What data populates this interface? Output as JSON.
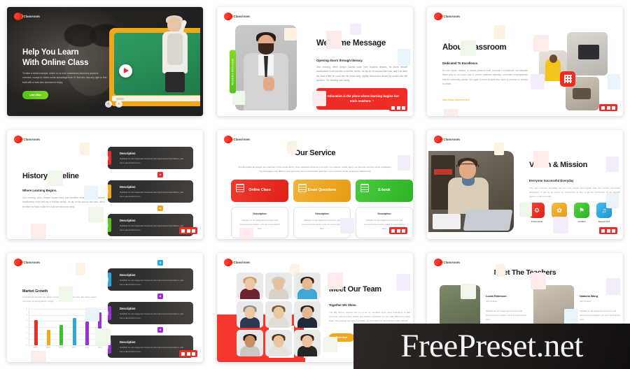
{
  "brand": {
    "logo_text": "Classroom",
    "accent_red": "#ee2b24",
    "accent_orange": "#f0a91e",
    "accent_green": "#56c51c",
    "accent_blue": "#2aa9e0",
    "accent_purple": "#9b30d9"
  },
  "watermark": {
    "text": "FreePreset.net"
  },
  "slides": [
    {
      "id": "hero",
      "title_line1": "Help You Learn",
      "title_line2": "With Online Class",
      "body": "To take a trivial example, which of us ever undertakes laborious physical exercise, except to obtain some advantage from it? But who has any right to find fault with a man who chooses to enjoy",
      "button": "Learn More",
      "prev": "‹",
      "next": "›"
    },
    {
      "id": "welcome",
      "vertical_tab": "Richard's First Issue",
      "heading": "Welcome Message",
      "subhead": "Opening doors through literacy.",
      "body": "One morning, when Gregor Samsa woke from troubled dreams, he found himself transformed in his bed into a horrible vermin. He lay on his armour-like back, and if he lifted his head a little he could see his brown belly, slightly domed and divided by arches into stiff sections. The bedding was hardly.",
      "quote": "“ Education is the place where learning begins but ends nowhere. ”"
    },
    {
      "id": "about",
      "heading": "About Classroom",
      "subhead": "Dedicated To Excellence.",
      "body": "No one rejects, dislikes, or avoids pleasure itself, because it is pleasure, but because those who do not know how to pursue pleasure rationally encounter consequences that are extremely painful. Nor again is there anyone who loves or pursues or desires to obtain.",
      "link": "https://www.classroom.com"
    },
    {
      "id": "history-timeline",
      "heading": "History Timeline",
      "subhead": "Where Learning Begins.",
      "body": "One morning, when Gregor Samsa woke from troubled dreams, he found himself transformed in his bed into a humble vermin. He lay on his armour-like back, and if he lifted his head a little he could see his brown belly.",
      "items": [
        {
          "tab": "2019",
          "title": "Description",
          "body": "Suitable for all categories business and personal presentation, just put a description here.",
          "color": "#ee2b24",
          "dot": "⚙"
        },
        {
          "tab": "2018",
          "title": "Description",
          "body": "Suitable for all categories business and personal presentation, just put a description here.",
          "color": "#f0a91e",
          "dot": "⚙"
        },
        {
          "tab": "2017",
          "title": "Description",
          "body": "Suitable for all categories business and personal presentation, just put a description here.",
          "color": "#56c51c",
          "dot": "⚙"
        }
      ]
    },
    {
      "id": "our-service",
      "heading": "Our Service",
      "intro": "The European languages are members of the same family. Their separate existence is a myth. For science, music, sport, etc, Europe uses the same vocabulary. The languages only differ in their grammar, their pronunciation and their most common words. Everyone realizes why",
      "cards": [
        {
          "label": "Online Class",
          "color": "#ee2b24",
          "desc_title": "Description",
          "desc_body": "Suitable for all categories business and personal presentation, just put a description here"
        },
        {
          "label": "Exam Questions",
          "color": "#f0a91e",
          "desc_title": "Description",
          "desc_body": "Suitable for all categories business and personal presentation, just put a description here"
        },
        {
          "label": "E-book",
          "color": "#3cbf30",
          "desc_title": "Description",
          "desc_body": "Suitable for all categories business and personal presentation, just put a description here"
        }
      ]
    },
    {
      "id": "vision-mission",
      "heading": "Vision & Mission",
      "subhead": "Everyone Successful Everyday",
      "body": "The new common language will be more simple and regular than the existing European languages. It will be as simple as Occidental; in fact, it will be Occidental. To an English person, it will seem like",
      "features": [
        {
          "label": "Professional",
          "color": "#ee2b24",
          "icon": "⚙"
        },
        {
          "label": "Knowledge",
          "color": "#f0a91e",
          "icon": "✿"
        },
        {
          "label": "Certified",
          "color": "#3cbf30",
          "icon": "⚑"
        },
        {
          "label": "Support 24/7",
          "color": "#2aa9e0",
          "icon": "♫"
        }
      ]
    },
    {
      "id": "market-growth",
      "chart_title": "Market Growth",
      "chart_sub": "A wonderful serenity has taken possession of my entire soul, like these sweet mornings of spring which I enjoy.",
      "items": [
        {
          "tab": "2019",
          "title": "Description",
          "body": "Suitable for all categories business and personal presentation, just put a description here.",
          "color": "#2aa9e0",
          "dot": "⚙"
        },
        {
          "tab": "2018",
          "title": "Description",
          "body": "Suitable for all categories business and personal presentation, just put a description here.",
          "color": "#9b30d9",
          "dot": "⚙"
        },
        {
          "tab": "2017",
          "title": "Description",
          "body": "Suitable for all categories business and personal presentation, just put a description here.",
          "color": "#9b30d9",
          "dot": "⚙"
        }
      ]
    },
    {
      "id": "meet-our-team",
      "heading": "Meet Our Team",
      "subhead": "Together We Shine.",
      "body": "The Big Oxmox advised her not to do so, because there were thousands of bad Commas, wild Question Marks and devious Semikoli, but the Little Blind Text didn't listen. She packed her seven versalia, put her initial into the belt and made herself.",
      "button": "Read More"
    },
    {
      "id": "meet-the-teachers",
      "heading": "Meet The Teachers",
      "teachers": [
        {
          "name": "Lucas Robinson",
          "role": "Job Position",
          "body": "Suitable for all categories business and personal presentation, just put a description here."
        },
        {
          "name": "Natasha Wang",
          "role": "Job Position",
          "body": "Suitable for all categories business and personal presentation, just put a description here."
        }
      ]
    }
  ],
  "chart_data": {
    "type": "bar",
    "title": "Market Growth",
    "categories": [
      "2014",
      "2015",
      "2016",
      "2017",
      "2018",
      "2019"
    ],
    "values": [
      4.2,
      2.5,
      3.4,
      4.5,
      3.9,
      5.4
    ],
    "colors": [
      "#ee2b24",
      "#f0a91e",
      "#3cbf30",
      "#2aa9e0",
      "#9b30d9",
      "#9b30d9"
    ],
    "xlabel": "",
    "ylabel": "",
    "ylim": [
      0,
      6
    ],
    "yticks": [
      0,
      1,
      2,
      3,
      4,
      5,
      6
    ],
    "grid": true,
    "legend": false
  }
}
